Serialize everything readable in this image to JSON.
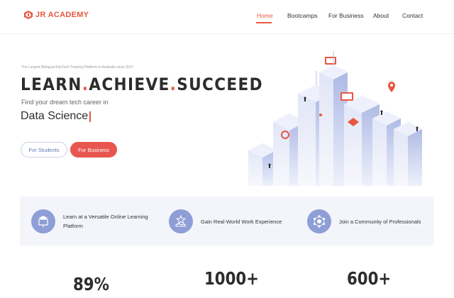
{
  "header": {
    "logo_text": "JR ACADEMY",
    "nav": [
      {
        "label": "Home",
        "active": true
      },
      {
        "label": "Bootcamps",
        "active": false
      },
      {
        "label": "For Business",
        "active": false
      },
      {
        "label": "About",
        "active": false
      },
      {
        "label": "Contact",
        "active": false
      }
    ]
  },
  "hero": {
    "tagline": "The Largest Bilingual EduTech Training Platform in Australia since 2017",
    "headline": {
      "w1": "LEARN",
      "w2": "ACHIEVE",
      "w3": "SUCCEED",
      "dot": "."
    },
    "subline": "Find your dream tech career in",
    "field": "Data Science",
    "buttons": {
      "students": "For Students",
      "business": "For Business"
    }
  },
  "features": [
    {
      "icon": "graduation-board-icon",
      "label": "Learn at a Versatile Online Learning Platform"
    },
    {
      "icon": "hand-star-icon",
      "label": "Gain Real-World Work Experience"
    },
    {
      "icon": "community-network-icon",
      "label": "Join a Community of Professionals"
    }
  ],
  "stats": [
    "89%",
    "1000+",
    "600+"
  ],
  "colors": {
    "accent": "#e8573f",
    "primary_soft": "#8e9ed6",
    "strip_bg": "#f3f5fb"
  }
}
